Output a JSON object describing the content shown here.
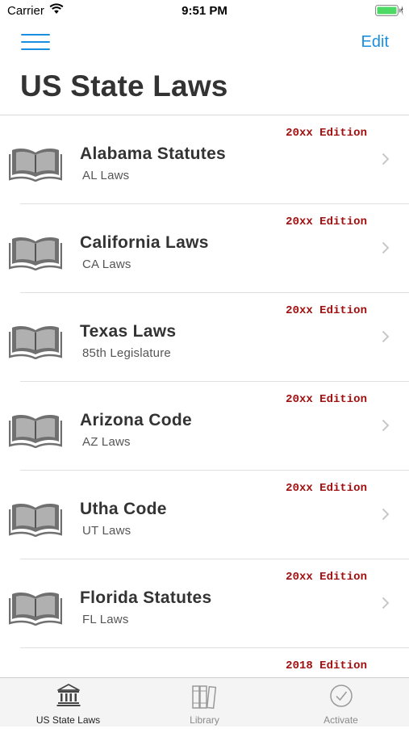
{
  "status_bar": {
    "carrier": "Carrier",
    "time": "9:51 PM"
  },
  "nav": {
    "edit_label": "Edit",
    "title": "US State Laws"
  },
  "list": [
    {
      "edition": "20xx Edition",
      "title": "Alabama Statutes",
      "subtitle": "AL Laws"
    },
    {
      "edition": "20xx Edition",
      "title": "California Laws",
      "subtitle": "CA Laws"
    },
    {
      "edition": "20xx Edition",
      "title": "Texas Laws",
      "subtitle": "85th Legislature"
    },
    {
      "edition": "20xx Edition",
      "title": "Arizona Code",
      "subtitle": "AZ Laws"
    },
    {
      "edition": "20xx Edition",
      "title": "Utha Code",
      "subtitle": "UT Laws"
    },
    {
      "edition": "20xx Edition",
      "title": "Florida Statutes",
      "subtitle": "FL Laws"
    },
    {
      "edition": "2018 Edition",
      "title": "",
      "subtitle": ""
    }
  ],
  "tab_bar": {
    "tabs": [
      {
        "label": "US State Laws",
        "icon": "courthouse-icon",
        "active": true
      },
      {
        "label": "Library",
        "icon": "books-icon",
        "active": false
      },
      {
        "label": "Activate",
        "icon": "checkmark-circle-icon",
        "active": false
      }
    ]
  },
  "colors": {
    "accent": "#1a8fe0",
    "edition": "#a01010",
    "title_text": "#333333",
    "icon_gray": "#707070"
  }
}
